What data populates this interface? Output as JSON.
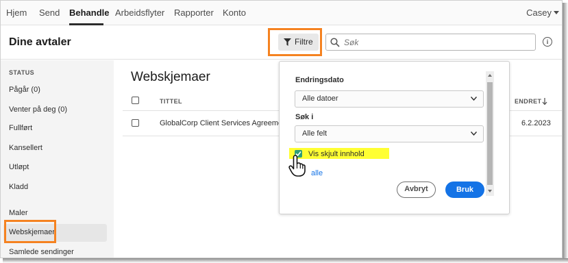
{
  "nav": {
    "items": [
      "Hjem",
      "Send",
      "Behandle",
      "Arbeidsflyter",
      "Rapporter",
      "Konto"
    ],
    "active_index": 2,
    "user": "Casey"
  },
  "header": {
    "title": "Dine avtaler",
    "filter_label": "Filtre",
    "search_placeholder": "Søk"
  },
  "sidebar": {
    "status_heading": "STATUS",
    "status_items": [
      "Pågår (0)",
      "Venter på deg (0)",
      "Fullført",
      "Kansellert",
      "Utløpt",
      "Kladd"
    ],
    "other_items": [
      "Maler",
      "Webskjemaer",
      "Samlede sendinger"
    ],
    "selected": "Webskjemaer"
  },
  "main": {
    "title": "Webskjemaer",
    "columns": {
      "title": "TITTEL",
      "modified": "ENDRET"
    },
    "rows": [
      {
        "title": "GlobalCorp Client Services Agreement",
        "modified": "6.2.2023"
      }
    ]
  },
  "filter_panel": {
    "modified_label": "Endringsdato",
    "modified_value": "Alle datoer",
    "search_in_label": "Søk i",
    "search_in_value": "Alle felt",
    "show_hidden_label": "Vis skjult innhold",
    "show_hidden_checked": true,
    "show_all_link": "alle",
    "cancel_label": "Avbryt",
    "apply_label": "Bruk"
  },
  "colors": {
    "accent_blue": "#1473e6",
    "highlight_orange": "#f58220",
    "highlight_yellow": "#ffff33",
    "checkbox_green": "#2d9d78"
  },
  "icons": [
    "funnel-icon",
    "search-icon",
    "info-icon",
    "chevron-down-icon",
    "sort-arrow-down-icon",
    "checkmark-icon",
    "hand-cursor-icon"
  ]
}
